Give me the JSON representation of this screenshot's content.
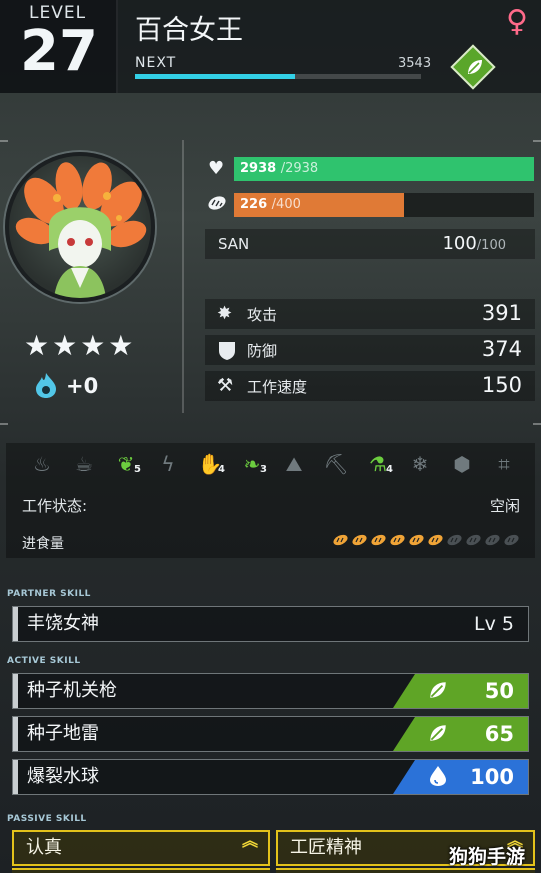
{
  "level": {
    "label": "LEVEL",
    "value": "27"
  },
  "pal": {
    "name": "百合女王",
    "gender_symbol": "♀",
    "element_icon": "leaf-icon",
    "element_color": "#5aa62a",
    "next_label": "NEXT",
    "next_value": "3543",
    "xp_progress": 0.56,
    "stars": "★★★★",
    "soul_bonus": "+0"
  },
  "stats": {
    "hp": {
      "current": "2938",
      "max": "/2938",
      "ratio": 1.0,
      "color": "#2fc36e"
    },
    "hunger": {
      "current": "226",
      "max": "/400",
      "ratio": 0.565,
      "color": "#e07a36"
    },
    "san": {
      "label": "SAN",
      "current": "100",
      "max": "/100"
    },
    "attack": {
      "label": "攻击",
      "value": "391"
    },
    "defense": {
      "label": "防御",
      "value": "374"
    },
    "work_speed": {
      "label": "工作速度",
      "value": "150"
    }
  },
  "work": {
    "suitabilities": [
      {
        "icon": "flame-icon",
        "level": "",
        "active": false
      },
      {
        "icon": "watering-can-icon",
        "level": "",
        "active": false
      },
      {
        "icon": "sprout-icon",
        "level": "5",
        "active": true
      },
      {
        "icon": "lightning-icon",
        "level": "",
        "active": false
      },
      {
        "icon": "hand-icon",
        "level": "4",
        "active": true
      },
      {
        "icon": "leaf-gather-icon",
        "level": "3",
        "active": true
      },
      {
        "icon": "ore-icon",
        "level": "",
        "active": false
      },
      {
        "icon": "pickaxe-icon",
        "level": "",
        "active": false
      },
      {
        "icon": "medicine-bowl-icon",
        "level": "4",
        "active": true
      },
      {
        "icon": "snowflake-icon",
        "level": "",
        "active": false
      },
      {
        "icon": "box-icon",
        "level": "",
        "active": false
      },
      {
        "icon": "farm-icon",
        "level": "",
        "active": false
      }
    ],
    "status_label": "工作状态:",
    "status_value": "空闲",
    "food_label": "进食量",
    "food_full": 6,
    "food_total": 10
  },
  "skills": {
    "partner_title": "PARTNER SKILL",
    "partner": {
      "name": "丰饶女神",
      "level": "Lv 5"
    },
    "active_title": "ACTIVE SKILL",
    "active": [
      {
        "name": "种子机关枪",
        "power": "50",
        "element": "leaf-icon",
        "color": "#5fa526"
      },
      {
        "name": "种子地雷",
        "power": "65",
        "element": "leaf-icon",
        "color": "#5fa526"
      },
      {
        "name": "爆裂水球",
        "power": "100",
        "element": "water-drop-icon",
        "color": "#2b72d8"
      }
    ],
    "passive_title": "PASSIVE SKILL",
    "passive": [
      {
        "name": "认真"
      },
      {
        "name": "工匠精神"
      }
    ]
  },
  "watermark": "狗狗手游"
}
